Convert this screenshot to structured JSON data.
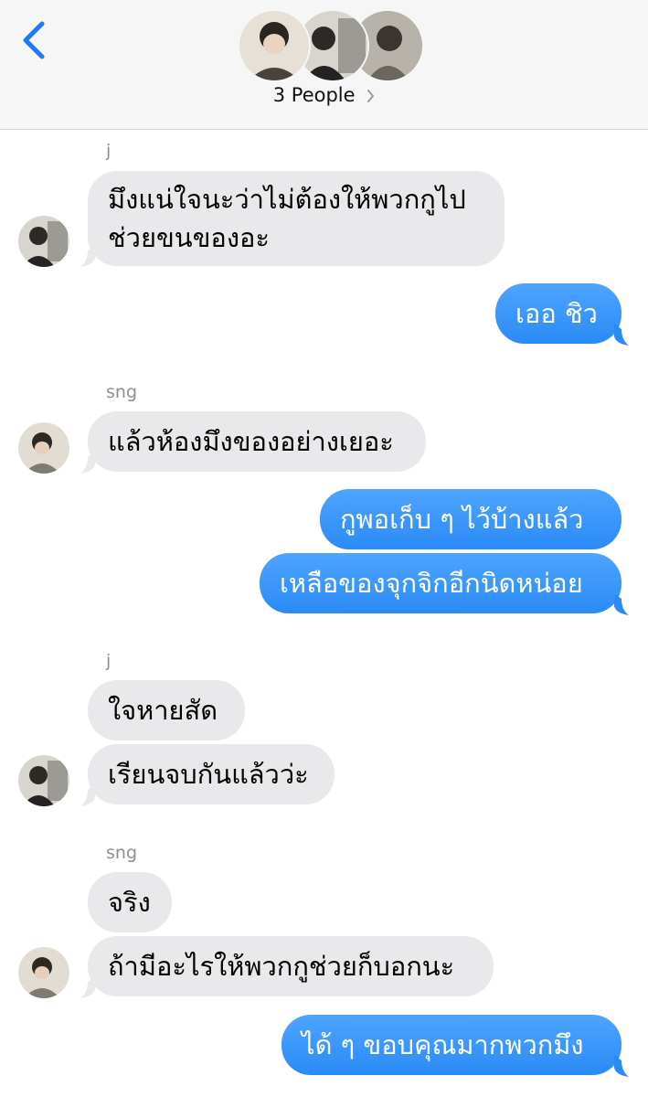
{
  "header": {
    "people_label": "3 People",
    "participants": [
      {
        "icon": "avatar-photo-icon"
      },
      {
        "icon": "avatar-photo-icon"
      },
      {
        "icon": "avatar-photo-icon"
      }
    ]
  },
  "messages": {
    "j_name_1": "j",
    "m1": "มึงแน่ใจนะว่าไม่ต้องให้พวกกูไป",
    "m1b": "ช่วยขนของอะ",
    "m2": "เออ ชิว",
    "sng_name_1": "sng",
    "m3": "แล้วห้องมึงของอย่างเยอะ",
    "m4": "กูพอเก็บ ๆ ไว้บ้างแล้ว",
    "m5": "เหลือของจุกจิกอีกนิดหน่อย",
    "j_name_2": "j",
    "m6": "ใจหายสัด",
    "m7": "เรียนจบกันแล้วว่ะ",
    "sng_name_2": "sng",
    "m8": "จริง",
    "m9": "ถ้ามีอะไรให้พวกกูช่วยก็บอกนะ",
    "m10": "ได้ ๆ ขอบคุณมากพวกมึง"
  },
  "colors": {
    "outgoing": "#2a8bf5",
    "incoming": "#e9e9eb",
    "accent": "#1b7cf5"
  }
}
